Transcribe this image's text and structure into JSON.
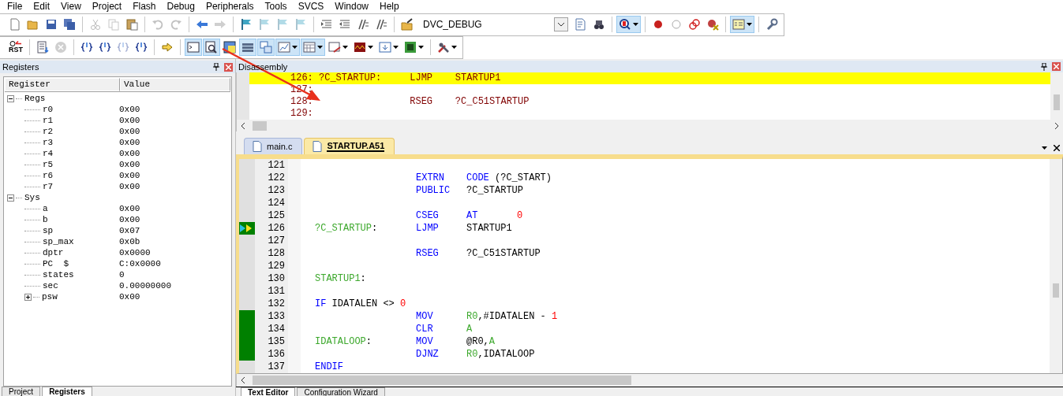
{
  "menu": [
    "File",
    "Edit",
    "View",
    "Project",
    "Flash",
    "Debug",
    "Peripherals",
    "Tools",
    "SVCS",
    "Window",
    "Help"
  ],
  "toolbars": [
    {
      "items": [
        {
          "kind": "button",
          "pressed": false,
          "disabled": false
        },
        {
          "kind": "button",
          "pressed": false,
          "disabled": false
        },
        {
          "kind": "button",
          "pressed": false,
          "disabled": false
        },
        {
          "kind": "button",
          "pressed": false,
          "disabled": false
        },
        {
          "kind": "separator"
        },
        {
          "kind": "button",
          "pressed": false,
          "disabled": true
        },
        {
          "kind": "button",
          "pressed": false,
          "disabled": true
        },
        {
          "kind": "button",
          "pressed": false,
          "disabled": false
        },
        {
          "kind": "separator"
        },
        {
          "kind": "button",
          "pressed": false,
          "disabled": true
        },
        {
          "kind": "button",
          "pressed": false,
          "disabled": true
        },
        {
          "kind": "separator"
        },
        {
          "kind": "button",
          "pressed": false,
          "disabled": false
        },
        {
          "kind": "button",
          "pressed": false,
          "disabled": true
        },
        {
          "kind": "separator"
        },
        {
          "kind": "button",
          "pressed": false,
          "disabled": false
        },
        {
          "kind": "button",
          "pressed": false,
          "disabled": true
        },
        {
          "kind": "button",
          "pressed": false,
          "disabled": true
        },
        {
          "kind": "button",
          "pressed": false,
          "disabled": true
        },
        {
          "kind": "separator"
        },
        {
          "kind": "button",
          "pressed": false,
          "disabled": false
        },
        {
          "kind": "button",
          "pressed": false,
          "disabled": false
        },
        {
          "kind": "button",
          "pressed": false,
          "disabled": false
        },
        {
          "kind": "button",
          "pressed": false,
          "disabled": false
        },
        {
          "kind": "separator"
        },
        {
          "kind": "button",
          "pressed": false,
          "disabled": false
        },
        {
          "kind": "select",
          "value": "DVC_DEBUG"
        },
        {
          "kind": "button",
          "pressed": false,
          "disabled": false
        },
        {
          "kind": "button",
          "pressed": false,
          "disabled": false
        },
        {
          "kind": "separator"
        },
        {
          "kind": "split",
          "pressed": true,
          "disabled": false
        },
        {
          "kind": "separator"
        },
        {
          "kind": "button",
          "pressed": false,
          "disabled": false
        },
        {
          "kind": "button",
          "pressed": false,
          "disabled": false
        },
        {
          "kind": "button",
          "pressed": false,
          "disabled": false
        },
        {
          "kind": "button",
          "pressed": false,
          "disabled": false
        },
        {
          "kind": "separator"
        },
        {
          "kind": "split",
          "pressed": true,
          "disabled": false
        },
        {
          "kind": "separator"
        },
        {
          "kind": "button",
          "pressed": false,
          "disabled": false
        }
      ]
    },
    {
      "items": [
        {
          "kind": "text-button",
          "label": "RST",
          "pressed": false,
          "disabled": false
        },
        {
          "kind": "separator"
        },
        {
          "kind": "button",
          "pressed": false,
          "disabled": false
        },
        {
          "kind": "button",
          "pressed": false,
          "disabled": true
        },
        {
          "kind": "separator"
        },
        {
          "kind": "button",
          "pressed": false,
          "disabled": false
        },
        {
          "kind": "button",
          "pressed": false,
          "disabled": false
        },
        {
          "kind": "button",
          "pressed": false,
          "disabled": true
        },
        {
          "kind": "button",
          "pressed": false,
          "disabled": false
        },
        {
          "kind": "separator"
        },
        {
          "kind": "button",
          "pressed": false,
          "disabled": false
        },
        {
          "kind": "separator"
        },
        {
          "kind": "button",
          "pressed": true,
          "disabled": false
        },
        {
          "kind": "button",
          "pressed": true,
          "disabled": false
        },
        {
          "kind": "button",
          "pressed": false,
          "disabled": false
        },
        {
          "kind": "button",
          "pressed": true,
          "disabled": false
        },
        {
          "kind": "button",
          "pressed": true,
          "disabled": false
        },
        {
          "kind": "split",
          "pressed": true,
          "disabled": false
        },
        {
          "kind": "split",
          "pressed": true,
          "disabled": false
        },
        {
          "kind": "split",
          "pressed": false,
          "disabled": false
        },
        {
          "kind": "split",
          "pressed": false,
          "disabled": false
        },
        {
          "kind": "split",
          "pressed": false,
          "disabled": false
        },
        {
          "kind": "split",
          "pressed": false,
          "disabled": false
        },
        {
          "kind": "separator"
        },
        {
          "kind": "split",
          "pressed": false,
          "disabled": false
        }
      ]
    }
  ],
  "registers_panel": {
    "title": "Registers",
    "columns": [
      "Register",
      "Value"
    ],
    "tree": [
      {
        "name": "Regs",
        "expanded": true,
        "children": [
          {
            "name": "r0",
            "value": "0x00"
          },
          {
            "name": "r1",
            "value": "0x00"
          },
          {
            "name": "r2",
            "value": "0x00"
          },
          {
            "name": "r3",
            "value": "0x00"
          },
          {
            "name": "r4",
            "value": "0x00"
          },
          {
            "name": "r5",
            "value": "0x00"
          },
          {
            "name": "r6",
            "value": "0x00"
          },
          {
            "name": "r7",
            "value": "0x00"
          }
        ]
      },
      {
        "name": "Sys",
        "expanded": true,
        "children": [
          {
            "name": "a",
            "value": "0x00"
          },
          {
            "name": "b",
            "value": "0x00"
          },
          {
            "name": "sp",
            "value": "0x07"
          },
          {
            "name": "sp_max",
            "value": "0x0b"
          },
          {
            "name": "dptr",
            "value": "0x0000"
          },
          {
            "name": "PC  $",
            "value": "C:0x0000"
          },
          {
            "name": "states",
            "value": "0"
          },
          {
            "name": "sec",
            "value": "0.00000000"
          },
          {
            "name": "psw",
            "value": "0x00",
            "expanded": false
          }
        ]
      }
    ],
    "tabs": [
      {
        "label": "Project",
        "selected": false
      },
      {
        "label": "Registers",
        "selected": true
      }
    ]
  },
  "disassembly": {
    "title": "Disassembly",
    "lines": [
      {
        "text": "126: ?C_STARTUP:     LJMP    STARTUP1",
        "selected": true
      },
      {
        "text": "127:",
        "selected": false
      },
      {
        "text": "128:                 RSEG    ?C_C51STARTUP",
        "selected": false
      },
      {
        "text": "129:",
        "selected": false
      }
    ]
  },
  "editor": {
    "tabs": [
      {
        "label": "main.c",
        "selected": false
      },
      {
        "label": "STARTUP.A51",
        "selected": true
      }
    ],
    "lines": [
      {
        "number": "121",
        "executed": false,
        "current": false
      },
      {
        "number": "122",
        "executed": false,
        "current": false,
        "op": [
          {
            "text": "EXTRN",
            "kind": "kw"
          }
        ],
        "args": [
          {
            "text": "CODE",
            "kind": "kw"
          },
          {
            "text": " (?C_START)",
            "kind": "plain"
          }
        ]
      },
      {
        "number": "123",
        "executed": false,
        "current": false,
        "op": [
          {
            "text": "PUBLIC",
            "kind": "kw"
          }
        ],
        "args": [
          {
            "text": "?C_STARTUP",
            "kind": "plain"
          }
        ]
      },
      {
        "number": "124",
        "executed": false,
        "current": false
      },
      {
        "number": "125",
        "executed": false,
        "current": false,
        "op": [
          {
            "text": "CSEG",
            "kind": "kw"
          }
        ],
        "args": [
          {
            "text": "AT",
            "kind": "kw"
          }
        ],
        "value": [
          {
            "text": "0",
            "kind": "num"
          }
        ]
      },
      {
        "number": "126",
        "executed": true,
        "current": true,
        "label": [
          {
            "text": "?C_STARTUP",
            "kind": "label"
          },
          {
            "text": ":",
            "kind": "plain"
          }
        ],
        "op": [
          {
            "text": "LJMP",
            "kind": "kw"
          }
        ],
        "args": [
          {
            "text": "STARTUP1",
            "kind": "plain"
          }
        ]
      },
      {
        "number": "127",
        "executed": false,
        "current": false
      },
      {
        "number": "128",
        "executed": false,
        "current": false,
        "op": [
          {
            "text": "RSEG",
            "kind": "kw"
          }
        ],
        "args": [
          {
            "text": "?C_C51STARTUP",
            "kind": "plain"
          }
        ]
      },
      {
        "number": "129",
        "executed": false,
        "current": false
      },
      {
        "number": "130",
        "executed": false,
        "current": false,
        "label": [
          {
            "text": "STARTUP1",
            "kind": "label"
          },
          {
            "text": ":",
            "kind": "plain"
          }
        ]
      },
      {
        "number": "131",
        "executed": false,
        "current": false
      },
      {
        "number": "132",
        "executed": false,
        "current": false,
        "label": [
          {
            "text": "IF",
            "kind": "kw"
          },
          {
            "text": " IDATALEN <> ",
            "kind": "plain"
          },
          {
            "text": "0",
            "kind": "num"
          }
        ]
      },
      {
        "number": "133",
        "executed": true,
        "current": false,
        "op": [
          {
            "text": "MOV",
            "kind": "kw"
          }
        ],
        "args": [
          {
            "text": "R0",
            "kind": "label"
          },
          {
            "text": ",#IDATALEN - ",
            "kind": "plain"
          },
          {
            "text": "1",
            "kind": "num"
          }
        ]
      },
      {
        "number": "134",
        "executed": true,
        "current": false,
        "op": [
          {
            "text": "CLR",
            "kind": "kw"
          }
        ],
        "args": [
          {
            "text": "A",
            "kind": "label"
          }
        ]
      },
      {
        "number": "135",
        "executed": true,
        "current": false,
        "label": [
          {
            "text": "IDATALOOP",
            "kind": "label"
          },
          {
            "text": ":",
            "kind": "plain"
          }
        ],
        "op": [
          {
            "text": "MOV",
            "kind": "kw"
          }
        ],
        "args": [
          {
            "text": "@R0,",
            "kind": "plain"
          },
          {
            "text": "A",
            "kind": "label"
          }
        ]
      },
      {
        "number": "136",
        "executed": true,
        "current": false,
        "op": [
          {
            "text": "DJNZ",
            "kind": "kw"
          }
        ],
        "args": [
          {
            "text": "R0",
            "kind": "label"
          },
          {
            "text": ",IDATALOOP",
            "kind": "plain"
          }
        ]
      },
      {
        "number": "137",
        "executed": false,
        "current": false,
        "label": [
          {
            "text": "ENDIF",
            "kind": "kw"
          }
        ]
      }
    ],
    "bottom_tabs": [
      {
        "label": "Text Editor",
        "selected": true
      },
      {
        "label": "Configuration Wizard",
        "selected": false
      }
    ]
  }
}
